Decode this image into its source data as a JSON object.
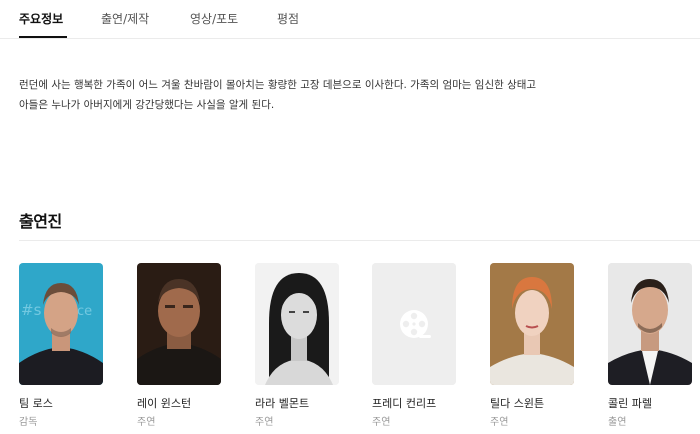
{
  "tabs": [
    {
      "label": "주요정보",
      "active": true
    },
    {
      "label": "출연/제작",
      "active": false
    },
    {
      "label": "영상/포토",
      "active": false
    },
    {
      "label": "평점",
      "active": false
    }
  ],
  "synopsis": {
    "line1": "런던에 사는 행복한 가족이 어느 겨울 찬바람이 몰아치는 황량한 고장 데븐으로 이사한다. 가족의 엄마는 임신한 상태고",
    "line2": "아들은 누나가 아버지에게 강간당했다는 사실을 알게 된다."
  },
  "cast": {
    "title": "출연진",
    "members": [
      {
        "name": "팀 로스",
        "role": "감독",
        "photo_icon": "person-photo"
      },
      {
        "name": "레이 윈스턴",
        "role": "주연",
        "photo_icon": "person-photo"
      },
      {
        "name": "라라 벨몬트",
        "role": "주연",
        "photo_icon": "person-photo"
      },
      {
        "name": "프레디 컨리프",
        "role": "주연",
        "photo_icon": "film-reel-icon"
      },
      {
        "name": "틸다 스윈튼",
        "role": "주연",
        "photo_icon": "person-photo"
      },
      {
        "name": "콜린 파렐",
        "role": "출연",
        "photo_icon": "person-photo"
      }
    ]
  },
  "colors": {
    "accent": "#111111",
    "muted": "#999999",
    "divider": "#ebebeb",
    "placeholder_bg": "#eeeeee"
  }
}
